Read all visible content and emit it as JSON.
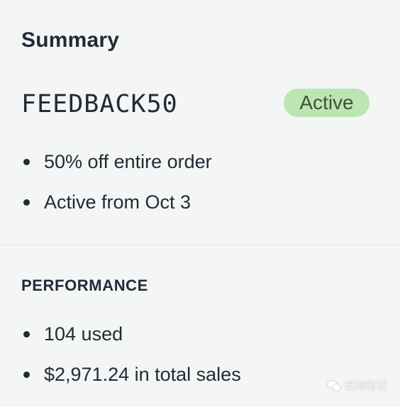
{
  "summary": {
    "title": "Summary",
    "code": "FEEDBACK50",
    "status_badge": "Active",
    "details": [
      "50% off entire order",
      "Active from Oct 3"
    ]
  },
  "performance": {
    "heading": "PERFORMANCE",
    "stats": [
      "104 used",
      "$2,971.24 in total sales"
    ]
  },
  "watermark": {
    "icon": "wechat-icon",
    "text": "出海笔记"
  },
  "colors": {
    "background": "#f4f5f5",
    "text": "#212b36",
    "badge_background": "#bbe5b3",
    "badge_text": "#414f3e",
    "divider": "#dfe3e8"
  }
}
